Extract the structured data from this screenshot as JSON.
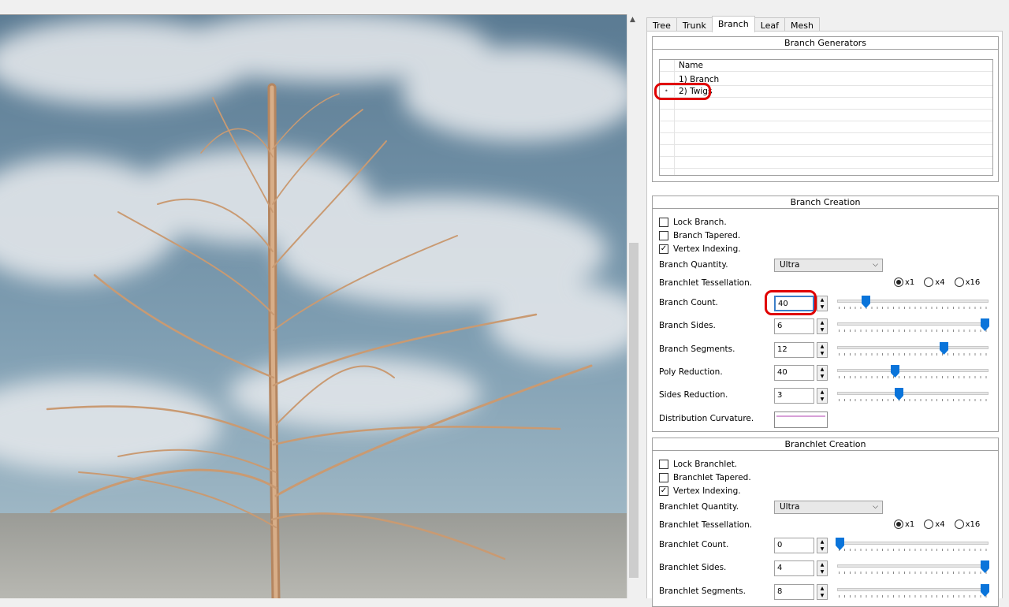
{
  "tabs": [
    "Tree",
    "Trunk",
    "Branch",
    "Leaf",
    "Mesh"
  ],
  "active_tab": "Branch",
  "generators": {
    "title": "Branch Generators",
    "header": "Name",
    "items": [
      "1) Branch",
      "2) Twigs"
    ],
    "selected_marker": "•"
  },
  "branch_creation": {
    "title": "Branch Creation",
    "lock": {
      "label": "Lock Branch.",
      "checked": false
    },
    "tapered": {
      "label": "Branch Tapered.",
      "checked": false
    },
    "vertex": {
      "label": "Vertex Indexing.",
      "checked": true
    },
    "quantity": {
      "label": "Branch Quantity.",
      "value": "Ultra"
    },
    "tess": {
      "label": "Branchlet Tessellation.",
      "options": [
        "x1",
        "x4",
        "x16"
      ],
      "selected": "x1"
    },
    "count": {
      "label": "Branch Count.",
      "value": "40",
      "slider": 0.18
    },
    "sides": {
      "label": "Branch Sides.",
      "value": "6",
      "slider": 1.0
    },
    "segments": {
      "label": "Branch Segments.",
      "value": "12",
      "slider": 0.72
    },
    "poly": {
      "label": "Poly Reduction.",
      "value": "40",
      "slider": 0.38
    },
    "sidesred": {
      "label": "Sides Reduction.",
      "value": "3",
      "slider": 0.41
    },
    "curvature": {
      "label": "Distribution Curvature."
    }
  },
  "branchlet_creation": {
    "title": "Branchlet Creation",
    "lock": {
      "label": "Lock Branchlet.",
      "checked": false
    },
    "tapered": {
      "label": "Branchlet Tapered.",
      "checked": false
    },
    "vertex": {
      "label": "Vertex Indexing.",
      "checked": true
    },
    "quantity": {
      "label": "Branchlet Quantity.",
      "value": "Ultra"
    },
    "tess": {
      "label": "Branchlet Tessellation.",
      "options": [
        "x1",
        "x4",
        "x16"
      ],
      "selected": "x1"
    },
    "count": {
      "label": "Branchlet Count.",
      "value": "0",
      "slider": 0.0
    },
    "sides": {
      "label": "Branchlet Sides.",
      "value": "4",
      "slider": 1.0
    },
    "segments": {
      "label": "Branchlet Segments.",
      "value": "8",
      "slider": 1.0
    }
  }
}
